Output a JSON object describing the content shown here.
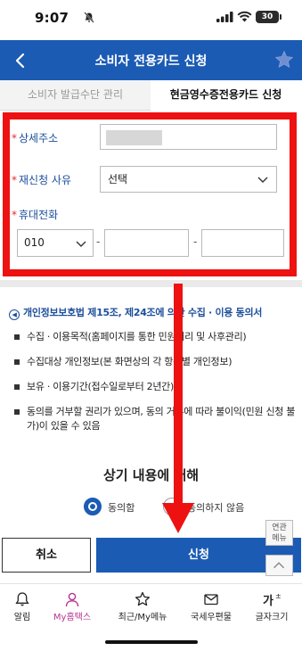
{
  "status_bar": {
    "time": "9:07",
    "battery": "30"
  },
  "header": {
    "title": "소비자 전용카드 신청"
  },
  "tabs": [
    {
      "label": "소비자 발급수단 관리",
      "active": false
    },
    {
      "label": "현금영수증전용카드 신청",
      "active": true
    }
  ],
  "form": {
    "address_label": "상세주소",
    "address_value": "",
    "reason_label": "재신청 사유",
    "reason_selected": "선택",
    "phone_label": "휴대전화",
    "phone_prefix": "010",
    "phone_middle": "",
    "phone_last": "",
    "separator": "-"
  },
  "consent": {
    "title": "개인정보보호법 제15조, 제24조에 의한 수집 · 이용 동의서",
    "items": [
      "수집 · 이용목적(홈페이지를 통한 민원처리 및 사후관리)",
      "수집대상 개인정보(본 화면상의 각 항목별 개인정보)",
      "보유 · 이용기간(접수일로부터 2년간)",
      "동의를 거부할 권리가 있으며, 동의 거부에 따라 불이익(민원 신청 불가)이 있을 수 있음"
    ],
    "question": "상기 내용에 대해",
    "agree_label": "동의함",
    "disagree_label": "동의하지 않음",
    "agree_selected": true
  },
  "side_menu": {
    "label_line1": "연관",
    "label_line2": "메뉴"
  },
  "actions": {
    "cancel": "취소",
    "submit": "신청"
  },
  "bottom_nav": [
    {
      "label": "알림",
      "icon": "bell-icon"
    },
    {
      "label": "My홈택스",
      "icon": "person-icon",
      "active": true
    },
    {
      "label": "최근/My메뉴",
      "icon": "star-icon"
    },
    {
      "label": "국세우편물",
      "icon": "mail-icon"
    },
    {
      "label": "글자크기",
      "icon": "text-size-icon"
    }
  ],
  "colors": {
    "primary": "#1c5bb4",
    "annotation": "#ee1111",
    "active_nav": "#b8338d"
  }
}
